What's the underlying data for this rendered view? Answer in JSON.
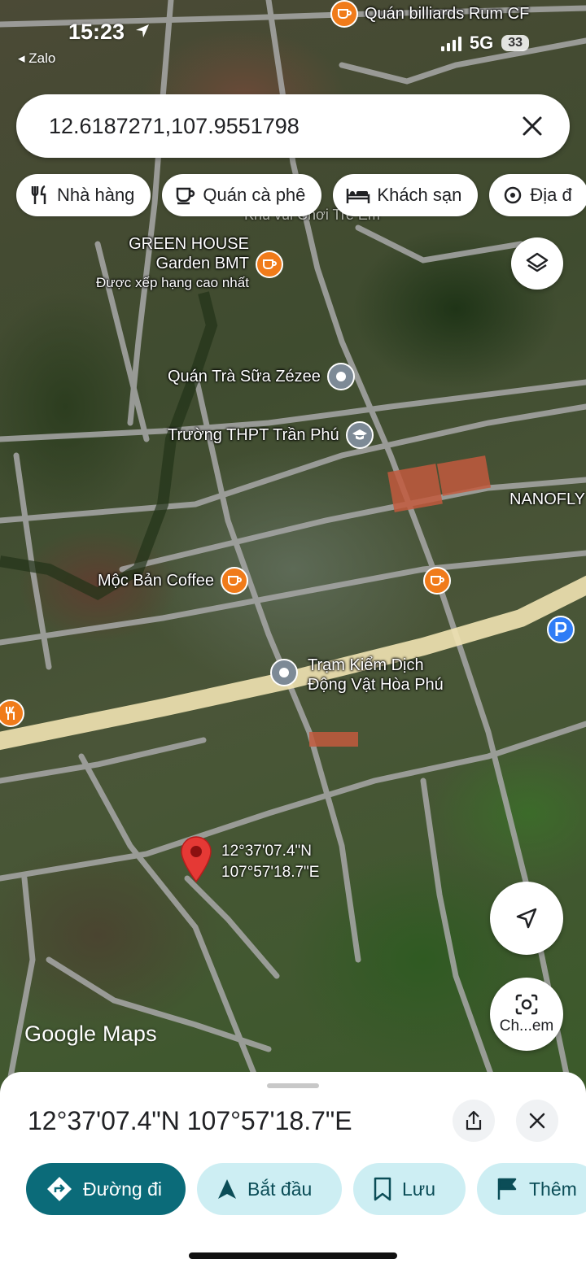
{
  "status": {
    "time": "15:23",
    "back_app": "◂ Zalo",
    "network": "5G",
    "battery": "33"
  },
  "search": {
    "query": "12.6187271,107.9551798"
  },
  "chips": [
    {
      "label": "Nhà hàng",
      "icon": "restaurant-icon"
    },
    {
      "label": "Quán cà phê",
      "icon": "coffee-icon"
    },
    {
      "label": "Khách sạn",
      "icon": "hotel-icon"
    },
    {
      "label": "Địa đ",
      "icon": "attraction-icon"
    }
  ],
  "map": {
    "pois": {
      "billiards": "Quán billiards Rum CF",
      "khu_vui_choi": "Khu vui Chơi Trẻ Em",
      "green_house_1": "GREEN HOUSE",
      "green_house_2": "Garden BMT",
      "green_house_rating": "Được xếp hạng cao nhất",
      "tra_sua": "Quán Trà Sữa Zézee",
      "truong": "Trường THPT Trần Phú",
      "nanofly": "NANOFLY",
      "moc_ban": "Mộc Bản Coffee",
      "tram_1": "Trạm Kiểm Dịch",
      "tram_2": "Động Vật Hòa Phú"
    },
    "pin": {
      "lat": "12°37'07.4\"N",
      "lng": "107°57'18.7\"E"
    },
    "logo": "Google Maps",
    "lens_label": "Ch...em"
  },
  "sheet": {
    "title": "12°37'07.4\"N 107°57'18.7\"E",
    "actions": {
      "directions": "Đường đi",
      "start": "Bắt đầu",
      "save": "Lưu",
      "more": "Thêm"
    }
  },
  "colors": {
    "accent": "#0b6b79",
    "chip_secondary": "#cdeef3",
    "pin_red": "#e53935",
    "poi_orange": "#f07b1a"
  }
}
